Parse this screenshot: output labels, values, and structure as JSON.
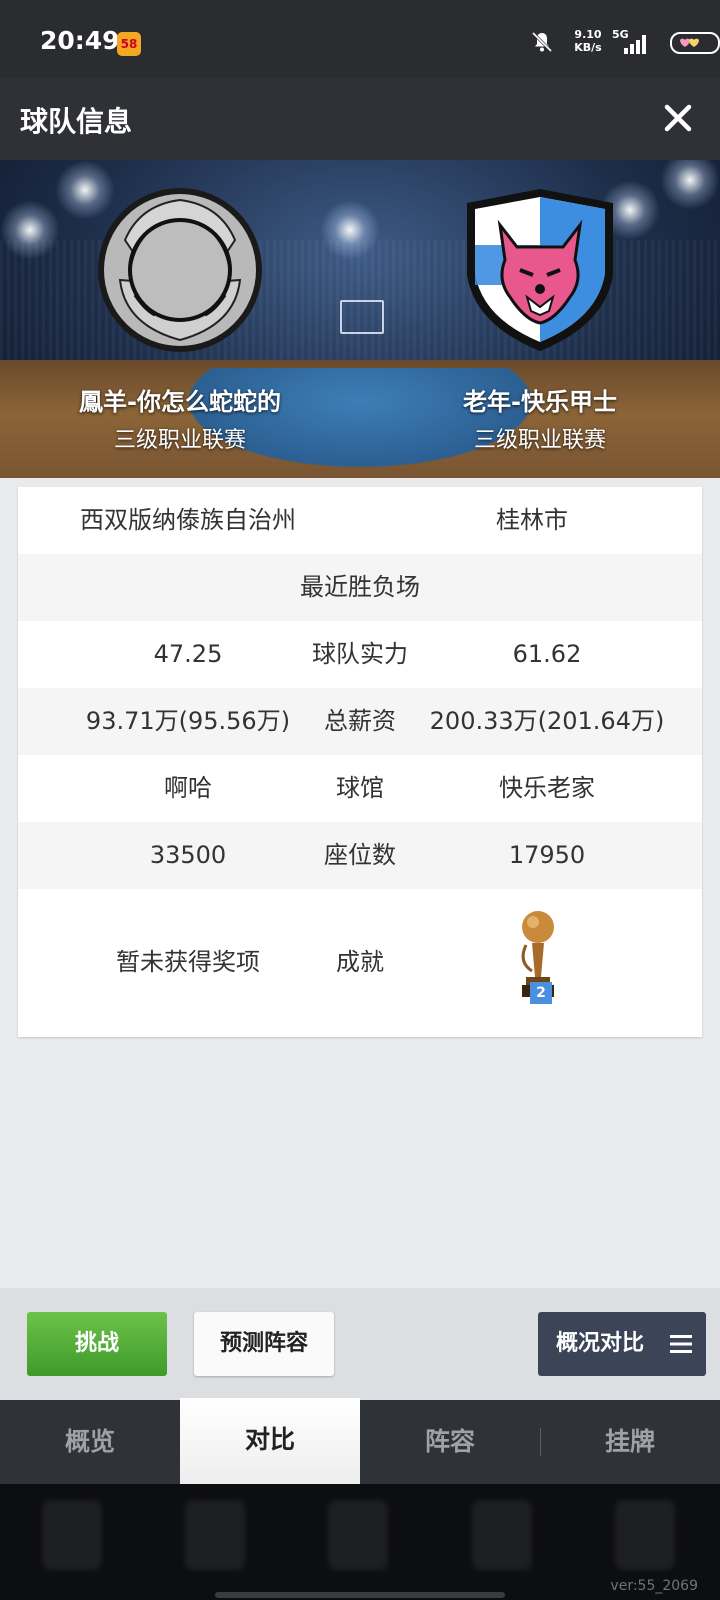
{
  "status_bar": {
    "time": "20:49",
    "app_badge": "58",
    "net_speed_value": "9.10",
    "net_speed_unit": "KB/s",
    "network": "5G"
  },
  "header": {
    "title": "球队信息"
  },
  "teams": {
    "left": {
      "name": "鳳羊-你怎么蛇蛇的",
      "league": "三级职业联赛"
    },
    "right": {
      "name": "老年-快乐甲士",
      "league": "三级职业联赛"
    }
  },
  "info": {
    "location_left": "西双版纳傣族自治州",
    "location_right": "桂林市",
    "recent_label": "最近胜负场",
    "rows": [
      {
        "left": "47.25",
        "label": "球队实力",
        "right": "61.62"
      },
      {
        "left": "93.71万(95.56万)",
        "label": "总薪资",
        "right": "200.33万(201.64万)"
      },
      {
        "left": "啊哈",
        "label": "球馆",
        "right": "快乐老家"
      },
      {
        "left": "33500",
        "label": "座位数",
        "right": "17950"
      }
    ],
    "achievement_left": "暂未获得奖项",
    "achievement_label": "成就",
    "trophy_count": "2"
  },
  "actions": {
    "challenge": "挑战",
    "predict": "预测阵容",
    "compare": "概况对比"
  },
  "tabs": [
    "概览",
    "对比",
    "阵容",
    "挂牌"
  ],
  "active_tab": "对比",
  "version": "ver:55_2069",
  "colors": {
    "accent_green": "#4caf3a",
    "header_bg": "#2f3136",
    "compare_btn": "#3b4557",
    "trophy_badge": "#4a8fe0"
  }
}
